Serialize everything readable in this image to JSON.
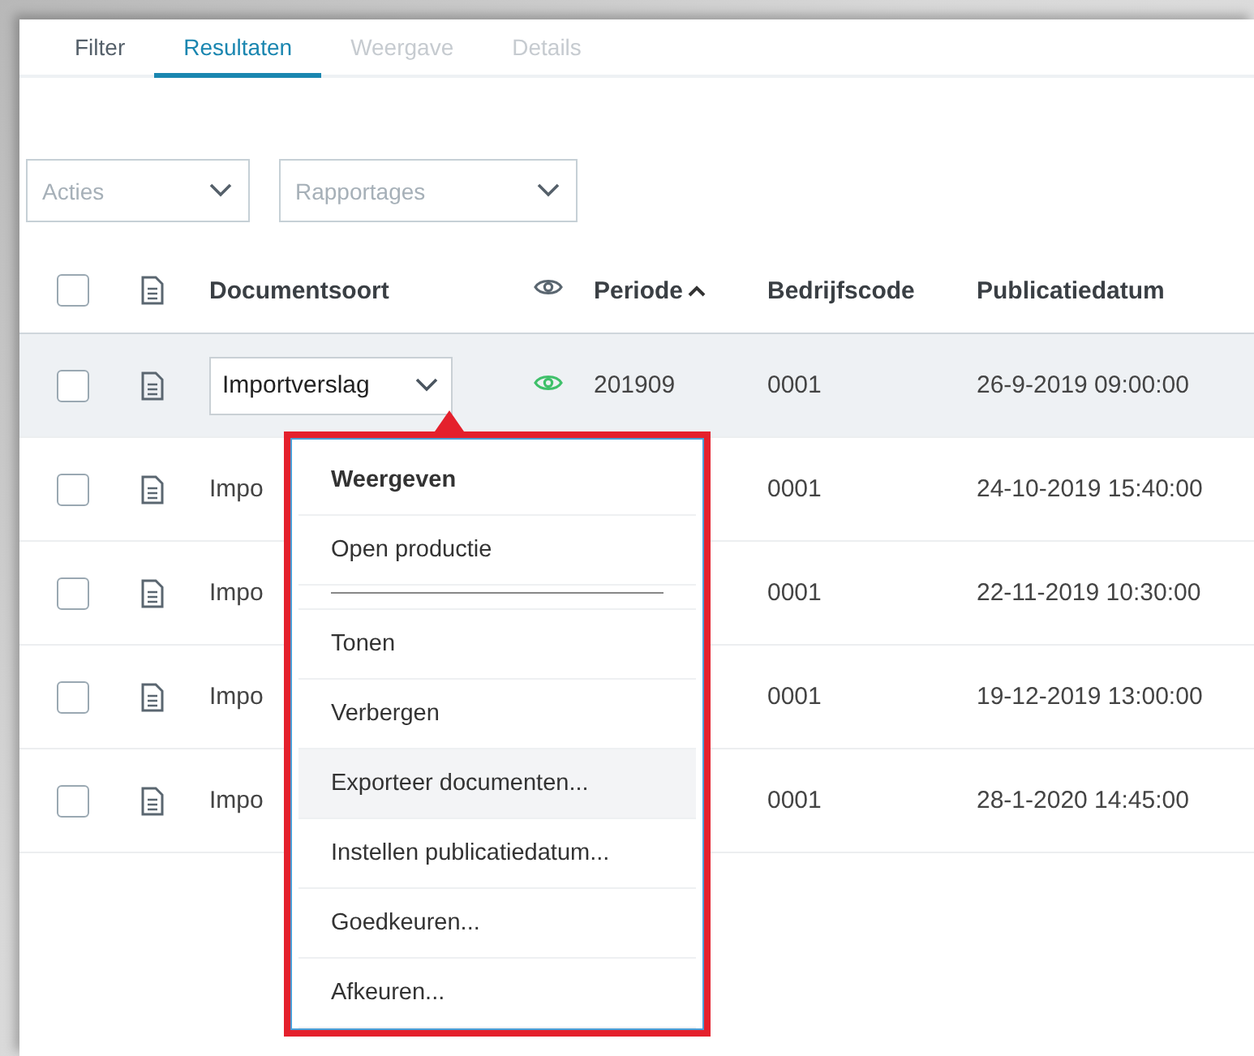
{
  "tabs": [
    {
      "label": "Filter",
      "selected": false,
      "disabled": false
    },
    {
      "label": "Resultaten",
      "selected": true,
      "disabled": false
    },
    {
      "label": "Weergave",
      "selected": false,
      "disabled": true
    },
    {
      "label": "Details",
      "selected": false,
      "disabled": true
    }
  ],
  "toolbar": {
    "dropdowns": [
      {
        "placeholder": "Acties"
      },
      {
        "placeholder": "Rapportages"
      }
    ]
  },
  "table": {
    "columns": [
      {
        "kind": "checkbox",
        "checked": false
      },
      {
        "kind": "document-icon"
      },
      {
        "kind": "text",
        "label": "Documentsoort"
      },
      {
        "kind": "eye-icon"
      },
      {
        "kind": "text",
        "label": "Periode",
        "sort_ascending": true
      },
      {
        "kind": "text",
        "label": "Bedrijfscode"
      },
      {
        "kind": "text",
        "label": "Publicatiedatum"
      }
    ],
    "rows": [
      {
        "checked": false,
        "hovered": true,
        "editing": true,
        "visible": true,
        "document_type": "Importverslag",
        "period": "201909",
        "company_code": "0001",
        "publication_date": "26-9-2019 09:00:00"
      },
      {
        "checked": false,
        "hovered": false,
        "editing": false,
        "document_type": "Impo",
        "company_code": "0001",
        "publication_date": "24-10-2019 15:40:00"
      },
      {
        "checked": false,
        "hovered": false,
        "editing": false,
        "document_type": "Impo",
        "company_code": "0001",
        "publication_date": "22-11-2019 10:30:00"
      },
      {
        "checked": false,
        "hovered": false,
        "editing": false,
        "document_type": "Impo",
        "company_code": "0001",
        "publication_date": "19-12-2019 13:00:00"
      },
      {
        "checked": false,
        "hovered": false,
        "editing": false,
        "document_type": "Impo",
        "company_code": "0001",
        "publication_date": "28-1-2020 14:45:00"
      }
    ]
  },
  "context_menu": {
    "items": [
      {
        "kind": "default",
        "label": "Weergeven",
        "hovered": false
      },
      {
        "kind": "item",
        "label": "Open productie",
        "hovered": false
      },
      {
        "kind": "separator"
      },
      {
        "kind": "item",
        "label": "Tonen",
        "hovered": false
      },
      {
        "kind": "item",
        "label": "Verbergen",
        "hovered": false
      },
      {
        "kind": "item",
        "label": "Exporteer documenten...",
        "hovered": true
      },
      {
        "kind": "item",
        "label": "Instellen publicatiedatum...",
        "hovered": false
      },
      {
        "kind": "item",
        "label": "Goedkeuren...",
        "hovered": false
      },
      {
        "kind": "item",
        "label": "Afkeuren...",
        "hovered": false
      }
    ]
  }
}
